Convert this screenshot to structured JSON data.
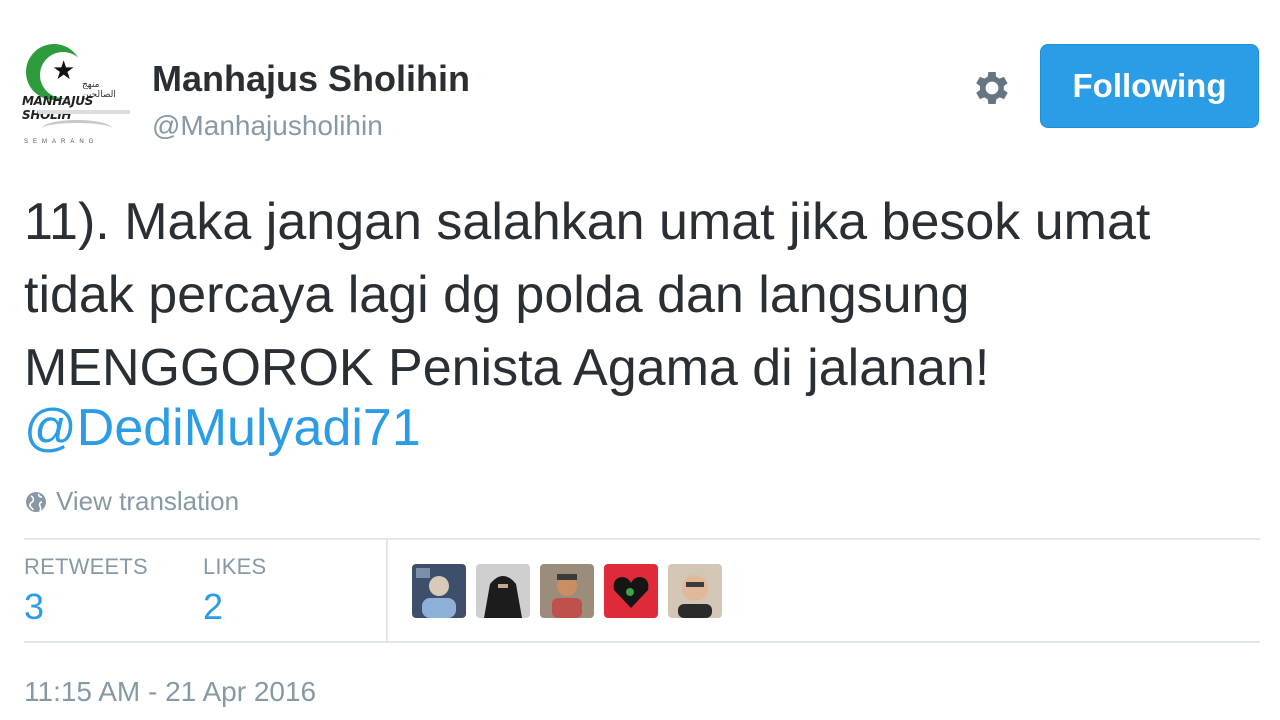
{
  "account": {
    "name": "Manhajus Sholihin",
    "handle": "@Manhajusholihin",
    "avatar_icon": "manhajus-sholihin-logo",
    "avatar_text": "MANHAJUS SHOLIH",
    "avatar_arabic": "منهج الصالحين",
    "avatar_city": "SEMARANG"
  },
  "header": {
    "settings_icon": "gear-icon",
    "follow_button": "Following",
    "accent": "#2b9ce6"
  },
  "tweet": {
    "lines": [
      "11). Maka jangan salahkan umat jika besok umat",
      "tidak percaya lagi dg polda dan langsung",
      "MENGGOROK Penista Agama di jalanan!"
    ],
    "mention": "@DediMulyadi71",
    "translate_label": "View translation",
    "translate_icon": "globe-icon"
  },
  "stats": {
    "retweets_label": "RETWEETS",
    "retweets_count": "3",
    "likes_label": "LIKES",
    "likes_count": "2"
  },
  "likers": [
    {
      "name": "liker-avatar-1",
      "color": "#5a6e8a"
    },
    {
      "name": "liker-avatar-2",
      "color": "#2a2a2a"
    },
    {
      "name": "liker-avatar-3",
      "color": "#8a7b6a"
    },
    {
      "name": "liker-avatar-4",
      "color": "#e02a3a"
    },
    {
      "name": "liker-avatar-5",
      "color": "#b59a82"
    }
  ],
  "timestamp": "11:15 AM - 21 Apr 2016"
}
